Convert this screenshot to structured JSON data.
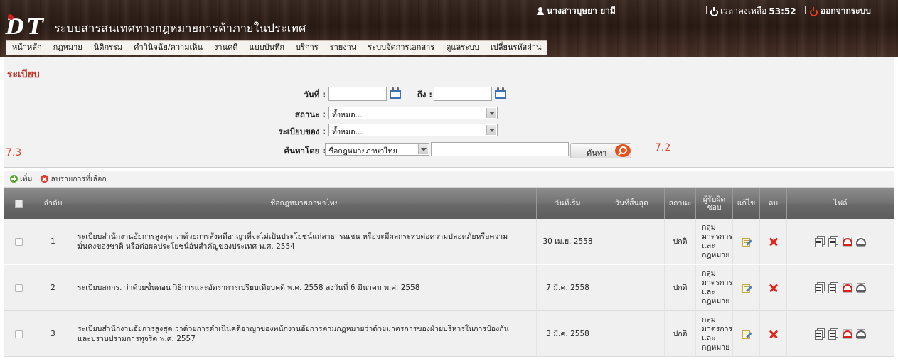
{
  "header": {
    "app_title": "ระบบสารสนเทศทางกฎหมายการค้าภายในประเทศ",
    "user_name": "นางสาวบุษยา ยามี",
    "session_label": "เวลาคงเหลือ",
    "session_time": "53:52",
    "logout_label": "ออกจากระบบ"
  },
  "menu": [
    "หน้าหลัก",
    "กฎหมาย",
    "นิติกรรม",
    "คำวินิจฉัย/ความเห็น",
    "งานคดี",
    "แบบบันทึก",
    "บริการ",
    "รายงาน",
    "ระบบจัดการเอกสาร",
    "ดูแลระบบ",
    "เปลี่ยนรหัสผ่าน"
  ],
  "page": {
    "title": "ระเบียบ",
    "annotation_left": "7.3",
    "annotation_right": "7.2"
  },
  "search": {
    "date_from_label": "วันที่ :",
    "date_from_value": "",
    "date_to_label": "ถึง :",
    "date_to_value": "",
    "status_label": "สถานะ :",
    "status_value": "ทั้งหมด...",
    "owner_label": "ระเบียบของ :",
    "owner_value": "ทั้งหมด...",
    "search_by_label": "ค้นหาโดย :",
    "search_by_value": "ชื่อกฎหมายภาษาไทย",
    "keyword_value": "",
    "search_button": "ค้นหา"
  },
  "toolbar": {
    "add_label": "เพิ่ม",
    "delete_selected_label": "ลบรายการที่เลือก"
  },
  "table": {
    "columns": [
      "",
      "ลำดับ",
      "ชื่อกฎหมายภาษาไทย",
      "วันที่เริ่ม",
      "วันที่สิ้นสุด",
      "สถานะ",
      "ผู้รับผิดชอบ",
      "แก้ไข",
      "ลบ",
      "ไฟล์"
    ],
    "rows": [
      {
        "no": "1",
        "name_line1": "ระเบียบสำนักงานอัยการสูงสุด ว่าด้วยการสั่งคดีอาญาที่จะไม่เป็นประโยชน์แก่สาธารณชน หรือจะมีผลกระทบต่อความปลอดภัยหรือความ",
        "name_line2": "มั่นคงของชาติ หรือต่อผลประโยชน์อันสำคัญของประเทศ พ.ศ. 2554",
        "start": "30 เม.ย. 2558",
        "end": "",
        "status": "ปกติ",
        "owner": [
          "กลุ่ม",
          "มาตรการ",
          "และ",
          "กฎหมาย"
        ]
      },
      {
        "no": "2",
        "name_line1": "ระเบียบสกกร. ว่าด้วยขั้นตอน วิธีการและอัตราการเปรียบเทียบคดี พ.ศ. 2558 ลงวันที่ 6 มีนาคม พ.ศ. 2558",
        "name_line2": "",
        "start": "7 มี.ค. 2558",
        "end": "",
        "status": "ปกติ",
        "owner": [
          "กลุ่ม",
          "มาตรการ",
          "และ",
          "กฎหมาย"
        ]
      },
      {
        "no": "3",
        "name_line1": "ระเบียบสำนักงานอัยการสูงสุด ว่าด้วยการดำเนินคดีอาญาของพนักงานอัยการตามกฎหมายว่าด้วยมาตรการของฝ่ายบริหารในการป้องกัน",
        "name_line2": "และปราบปรามการทุจริต พ.ศ. 2557",
        "start": "3 มี.ค. 2558",
        "end": "",
        "status": "ปกติ",
        "owner": [
          "กลุ่ม",
          "มาตรการ",
          "และ",
          "กฎหมาย"
        ]
      }
    ]
  }
}
